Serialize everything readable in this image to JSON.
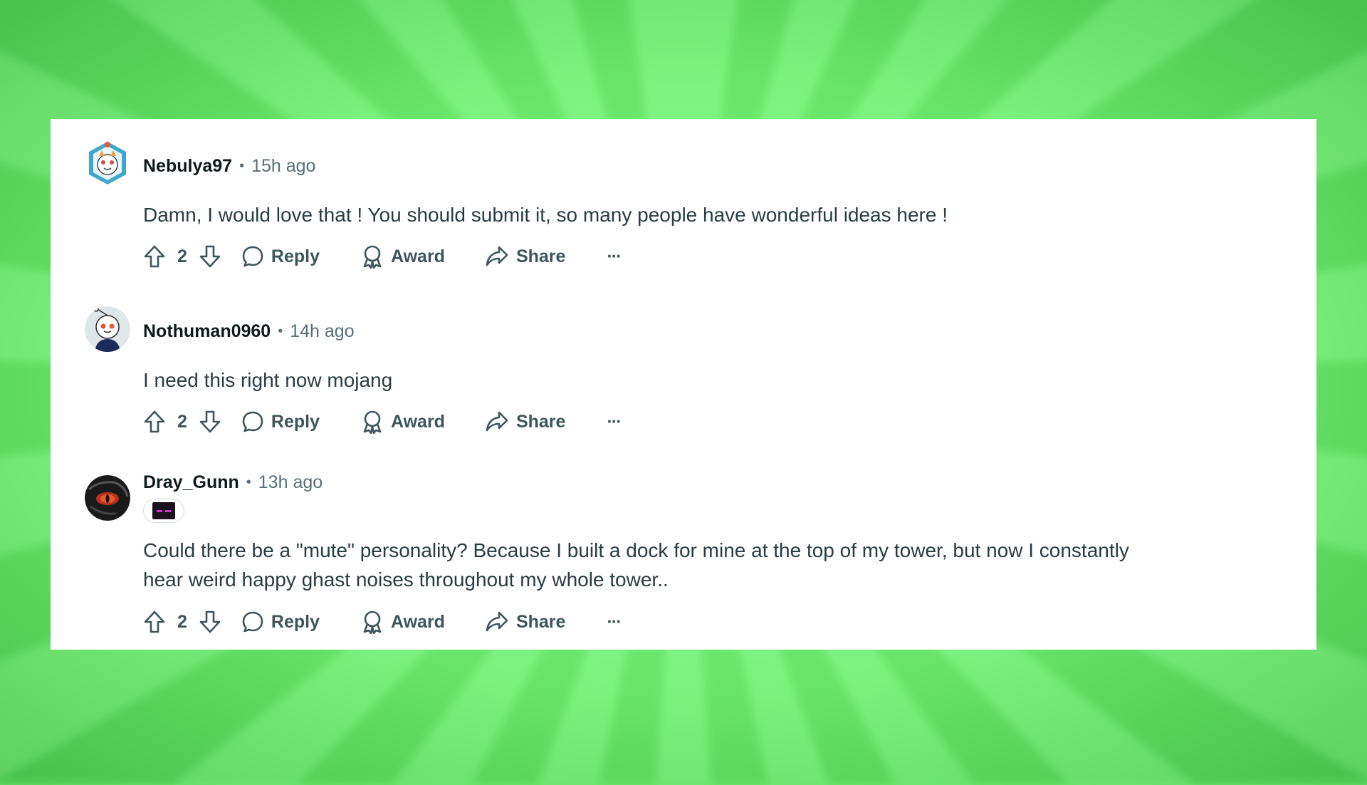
{
  "comments": [
    {
      "username": "Nebulya97",
      "separator": "•",
      "time": "15h ago",
      "text": "Damn, I would love that ! You should submit it, so many people have wonderful ideas here !",
      "votes": "2",
      "avatar_icon": "kitten-avatar-icon"
    },
    {
      "username": "Nothuman0960",
      "separator": "•",
      "time": "14h ago",
      "text": "I need this right now mojang",
      "votes": "2",
      "avatar_icon": "snoo-avatar-icon"
    },
    {
      "username": "Dray_Gunn",
      "separator": "•",
      "time": "13h ago",
      "text": "Could there be a \"mute\" personality? Because I built a dock for mine at the top of my tower, but now I constantly hear weird happy ghast noises throughout my whole tower..",
      "votes": "2",
      "avatar_icon": "dragon-eye-avatar-icon",
      "flair_icon": "enderman-flair-icon"
    }
  ],
  "actions": {
    "reply": "Reply",
    "award": "Award",
    "share": "Share",
    "more": "···"
  },
  "colors": {
    "background": "#6fe86f",
    "card": "#ffffff",
    "text": "#2a3c42",
    "meta": "#576f76"
  }
}
